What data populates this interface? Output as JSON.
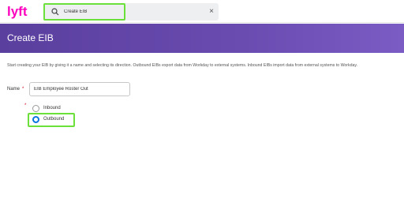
{
  "top_bar": {
    "logo": "lyft",
    "search": {
      "icon": "search-icon",
      "value": "Create EIB",
      "clear_icon": "×"
    }
  },
  "page": {
    "title": "Create EIB",
    "intro": "Start creating your EIB by giving it a name and selecting its direction. Outbound EIBs export data from Workday to external systems. Inbound EIBs import data from external systems to Workday."
  },
  "form": {
    "name_label": "Name",
    "required_marker": "*",
    "name_value": "EIB Employee Roster Out",
    "direction": {
      "options": [
        "Inbound",
        "Outbound"
      ],
      "selected": "Outbound"
    }
  },
  "colors": {
    "header_start": "#5a3f9e",
    "header_end": "#7a5cc4",
    "highlight": "#6be03a",
    "logo": "#ff00bf",
    "radio_selected": "#0875e1"
  }
}
